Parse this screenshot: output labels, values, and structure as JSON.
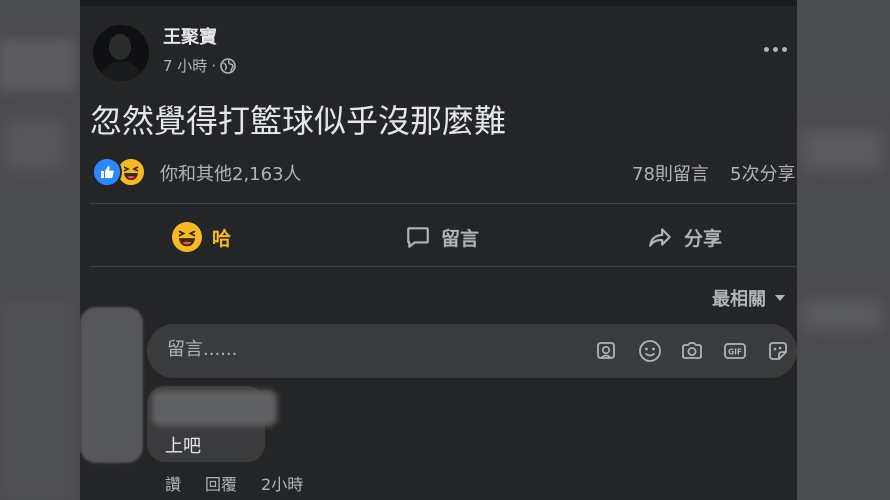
{
  "post": {
    "author": "王聚寶",
    "time": "7 小時",
    "time_sep": "·",
    "text": "忽然覺得打籃球似乎沒那麼難"
  },
  "stats": {
    "reactions_text": "你和其他2,163人",
    "comments": "78則留言",
    "shares": "5次分享"
  },
  "actions": {
    "haha_label": "哈",
    "comment_label": "留言",
    "share_label": "分享"
  },
  "sort": {
    "label": "最相關"
  },
  "composer": {
    "placeholder": "留言......"
  },
  "reply": {
    "text": "上吧",
    "like_label": "讚",
    "reply_label": "回覆",
    "time": "2小時"
  },
  "colors": {
    "card_bg": "#242526",
    "haha_accent": "#f7b928",
    "like_accent": "#2d88ff",
    "muted_text": "#b0b3b8"
  }
}
